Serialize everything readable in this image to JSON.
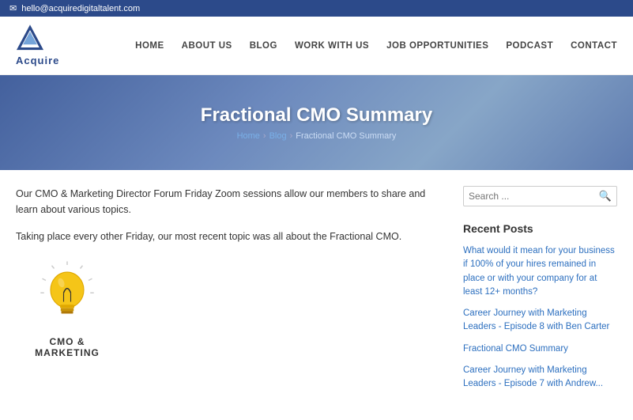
{
  "topbar": {
    "email": "hello@acquiredigitaltalent.com",
    "email_icon": "✉"
  },
  "header": {
    "logo_text": "Acquire",
    "nav_items": [
      {
        "label": "HOME",
        "id": "nav-home"
      },
      {
        "label": "ABOUT US",
        "id": "nav-about"
      },
      {
        "label": "BLOG",
        "id": "nav-blog"
      },
      {
        "label": "WORK WITH US",
        "id": "nav-work"
      },
      {
        "label": "JOB OPPORTUNITIES",
        "id": "nav-jobs"
      },
      {
        "label": "PODCAST",
        "id": "nav-podcast"
      },
      {
        "label": "CONTACT",
        "id": "nav-contact"
      }
    ]
  },
  "hero": {
    "title": "Fractional CMO Summary",
    "breadcrumb": [
      {
        "label": "Home",
        "href": "#"
      },
      {
        "label": "Blog",
        "href": "#"
      },
      {
        "label": "Fractional CMO Summary"
      }
    ]
  },
  "content": {
    "paragraph1": "Our CMO & Marketing Director Forum Friday Zoom sessions allow our members to share and learn about various topics.",
    "paragraph2": "Taking place every other Friday, our most recent topic was all about the Fractional CMO.",
    "cmo_label": "CMO & MARKETING"
  },
  "sidebar": {
    "search_placeholder": "Search ...",
    "search_button": "Search",
    "recent_posts_title": "Recent Posts",
    "recent_posts": [
      {
        "text": "What would it mean for your business if 100% of your hires remained in place or with your company for at least 12+ months?",
        "href": "#"
      },
      {
        "text": "Career Journey with Marketing Leaders - Episode 8 with Ben Carter",
        "href": "#"
      },
      {
        "text": "Fractional CMO Summary",
        "href": "#"
      },
      {
        "text": "Career Journey with Marketing Leaders - Episode 7 with Andrew...",
        "href": "#"
      }
    ]
  }
}
